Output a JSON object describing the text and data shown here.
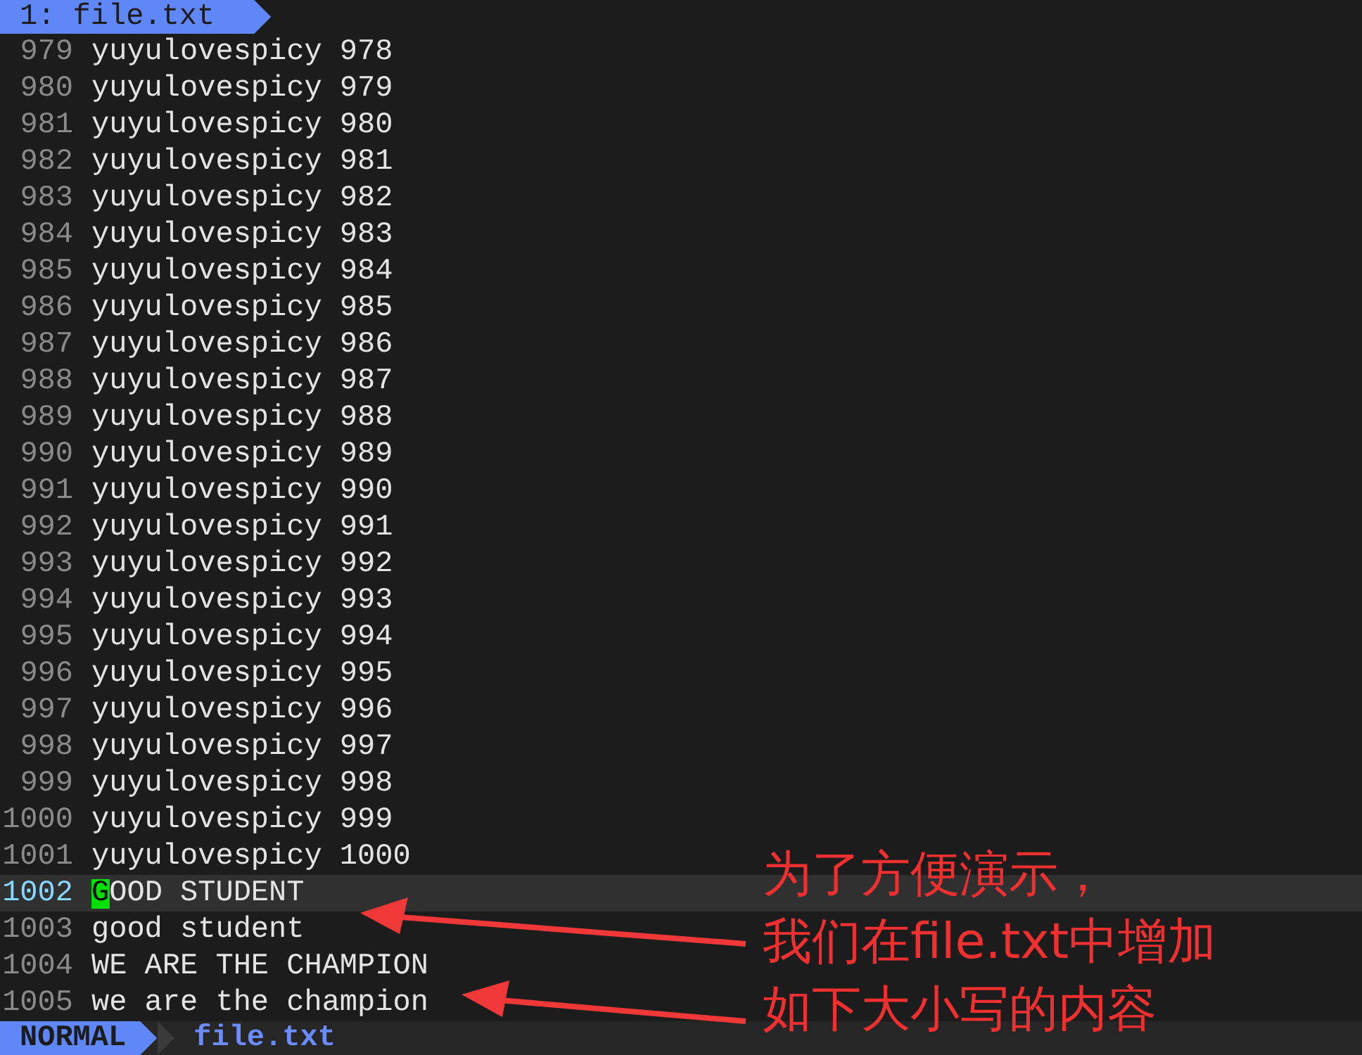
{
  "tabline": {
    "tab": {
      "label": "1: file.txt",
      "selected": true
    }
  },
  "lines": [
    {
      "number": "979",
      "text": "yuyulovespicy 978",
      "selected": false,
      "cursor": false
    },
    {
      "number": "980",
      "text": "yuyulovespicy 979",
      "selected": false,
      "cursor": false
    },
    {
      "number": "981",
      "text": "yuyulovespicy 980",
      "selected": false,
      "cursor": false
    },
    {
      "number": "982",
      "text": "yuyulovespicy 981",
      "selected": false,
      "cursor": false
    },
    {
      "number": "983",
      "text": "yuyulovespicy 982",
      "selected": false,
      "cursor": false
    },
    {
      "number": "984",
      "text": "yuyulovespicy 983",
      "selected": false,
      "cursor": false
    },
    {
      "number": "985",
      "text": "yuyulovespicy 984",
      "selected": false,
      "cursor": false
    },
    {
      "number": "986",
      "text": "yuyulovespicy 985",
      "selected": false,
      "cursor": false
    },
    {
      "number": "987",
      "text": "yuyulovespicy 986",
      "selected": false,
      "cursor": false
    },
    {
      "number": "988",
      "text": "yuyulovespicy 987",
      "selected": false,
      "cursor": false
    },
    {
      "number": "989",
      "text": "yuyulovespicy 988",
      "selected": false,
      "cursor": false
    },
    {
      "number": "990",
      "text": "yuyulovespicy 989",
      "selected": false,
      "cursor": false
    },
    {
      "number": "991",
      "text": "yuyulovespicy 990",
      "selected": false,
      "cursor": false
    },
    {
      "number": "992",
      "text": "yuyulovespicy 991",
      "selected": false,
      "cursor": false
    },
    {
      "number": "993",
      "text": "yuyulovespicy 992",
      "selected": false,
      "cursor": false
    },
    {
      "number": "994",
      "text": "yuyulovespicy 993",
      "selected": false,
      "cursor": false
    },
    {
      "number": "995",
      "text": "yuyulovespicy 994",
      "selected": false,
      "cursor": false
    },
    {
      "number": "996",
      "text": "yuyulovespicy 995",
      "selected": false,
      "cursor": false
    },
    {
      "number": "997",
      "text": "yuyulovespicy 996",
      "selected": false,
      "cursor": false
    },
    {
      "number": "998",
      "text": "yuyulovespicy 997",
      "selected": false,
      "cursor": false
    },
    {
      "number": "999",
      "text": "yuyulovespicy 998",
      "selected": false,
      "cursor": false
    },
    {
      "number": "1000",
      "text": "yuyulovespicy 999",
      "selected": false,
      "cursor": false
    },
    {
      "number": "1001",
      "text": "yuyulovespicy 1000",
      "selected": false,
      "cursor": false
    },
    {
      "number": "1002",
      "text": "GOOD STUDENT",
      "selected": true,
      "cursor": true
    },
    {
      "number": "1003",
      "text": "good student",
      "selected": false,
      "cursor": false
    },
    {
      "number": "1004",
      "text": "WE ARE THE CHAMPION",
      "selected": false,
      "cursor": false
    },
    {
      "number": "1005",
      "text": "we are the champion",
      "selected": false,
      "cursor": false
    }
  ],
  "status_bar": {
    "mode": "NORMAL",
    "file": "file.txt"
  },
  "annotation": {
    "lines": [
      "为了方便演示，",
      "我们在file.txt中增加",
      "如下大小写的内容"
    ]
  }
}
